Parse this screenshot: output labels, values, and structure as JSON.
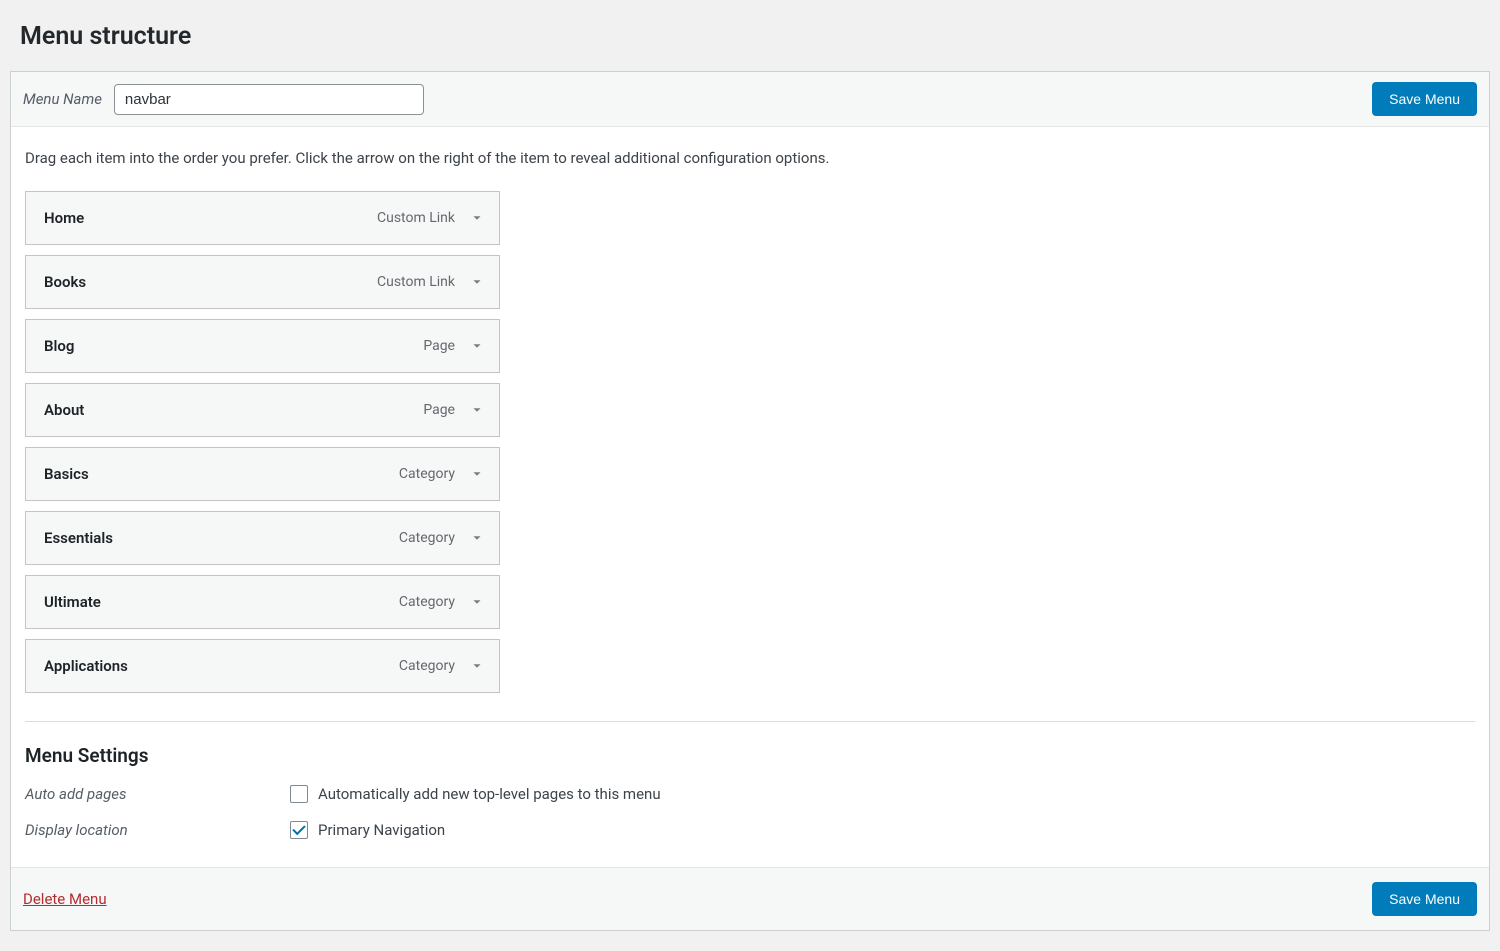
{
  "page_title": "Menu structure",
  "menu_name_label": "Menu Name",
  "menu_name_value": "navbar",
  "save_button_label": "Save Menu",
  "drag_instructions": "Drag each item into the order you prefer. Click the arrow on the right of the item to reveal additional configuration options.",
  "menu_items": [
    {
      "title": "Home",
      "type": "Custom Link"
    },
    {
      "title": "Books",
      "type": "Custom Link"
    },
    {
      "title": "Blog",
      "type": "Page"
    },
    {
      "title": "About",
      "type": "Page"
    },
    {
      "title": "Basics",
      "type": "Category"
    },
    {
      "title": "Essentials",
      "type": "Category"
    },
    {
      "title": "Ultimate",
      "type": "Category"
    },
    {
      "title": "Applications",
      "type": "Category"
    }
  ],
  "menu_settings_title": "Menu Settings",
  "settings": {
    "auto_add_label": "Auto add pages",
    "auto_add_checkbox_label": "Automatically add new top-level pages to this menu",
    "auto_add_checked": false,
    "display_location_label": "Display location",
    "display_location_checkbox_label": "Primary Navigation",
    "display_location_checked": true
  },
  "delete_menu_label": "Delete Menu"
}
